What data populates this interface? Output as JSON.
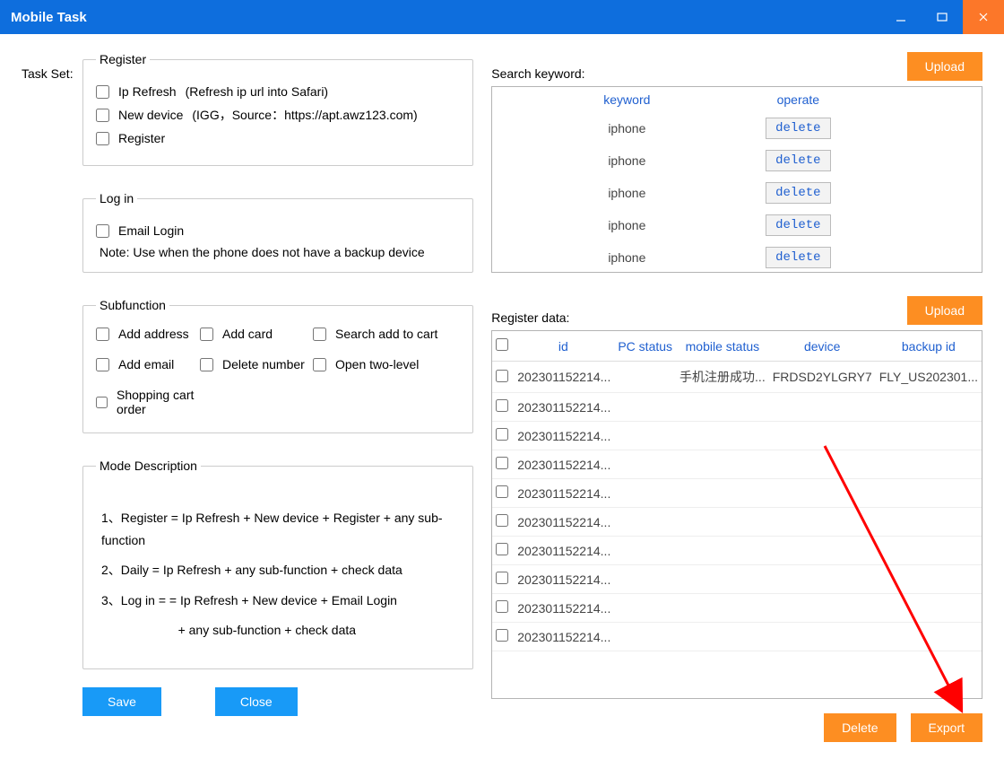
{
  "window": {
    "title": "Mobile Task"
  },
  "taskset_label": "Task Set:",
  "register": {
    "legend": "Register",
    "ip_refresh": "Ip Refresh",
    "ip_refresh_hint": "(Refresh ip url into Safari)",
    "new_device": "New device",
    "new_device_hint": "(IGG，Source：https://apt.awz123.com)",
    "register": "Register"
  },
  "login": {
    "legend": "Log in",
    "email_login": "Email Login",
    "note": "Note: Use when the phone does not have a backup device"
  },
  "subfunction": {
    "legend": "Subfunction",
    "add_address": "Add address",
    "add_card": "Add card",
    "search_add": "Search add to cart",
    "add_email": "Add email",
    "delete_number": "Delete number",
    "open_two": "Open two-level",
    "shopping_cart": "Shopping cart order"
  },
  "mode": {
    "legend": "Mode Description",
    "line1": "1、Register = Ip Refresh + New device + Register + any sub-function",
    "line2": "2、Daily =   Ip Refresh + any sub-function + check data",
    "line3": "3、Log in =  = Ip Refresh + New device + Email Login",
    "line4": "                      + any sub-function + check data"
  },
  "buttons": {
    "save": "Save",
    "close": "Close",
    "upload": "Upload",
    "delete": "Delete",
    "export": "Export"
  },
  "search_keyword": {
    "label": "Search keyword:",
    "header_keyword": "keyword",
    "header_operate": "operate",
    "delete_label": "delete",
    "rows": [
      {
        "k": "iphone"
      },
      {
        "k": "iphone"
      },
      {
        "k": "iphone"
      },
      {
        "k": "iphone"
      },
      {
        "k": "iphone"
      }
    ]
  },
  "register_data": {
    "label": "Register data:",
    "headers": {
      "id": "id",
      "pc": "PC status",
      "mobile": "mobile status",
      "device": "device",
      "backup": "backup id"
    },
    "rows": [
      {
        "id": "202301152214...",
        "pc": "",
        "mobile": "手机注册成功...",
        "device": "FRDSD2YLGRY7",
        "backup": "FLY_US202301..."
      },
      {
        "id": "202301152214...",
        "pc": "",
        "mobile": "",
        "device": "",
        "backup": ""
      },
      {
        "id": "202301152214...",
        "pc": "",
        "mobile": "",
        "device": "",
        "backup": ""
      },
      {
        "id": "202301152214...",
        "pc": "",
        "mobile": "",
        "device": "",
        "backup": ""
      },
      {
        "id": "202301152214...",
        "pc": "",
        "mobile": "",
        "device": "",
        "backup": ""
      },
      {
        "id": "202301152214...",
        "pc": "",
        "mobile": "",
        "device": "",
        "backup": ""
      },
      {
        "id": "202301152214...",
        "pc": "",
        "mobile": "",
        "device": "",
        "backup": ""
      },
      {
        "id": "202301152214...",
        "pc": "",
        "mobile": "",
        "device": "",
        "backup": ""
      },
      {
        "id": "202301152214...",
        "pc": "",
        "mobile": "",
        "device": "",
        "backup": ""
      },
      {
        "id": "202301152214...",
        "pc": "",
        "mobile": "",
        "device": "",
        "backup": ""
      }
    ]
  }
}
